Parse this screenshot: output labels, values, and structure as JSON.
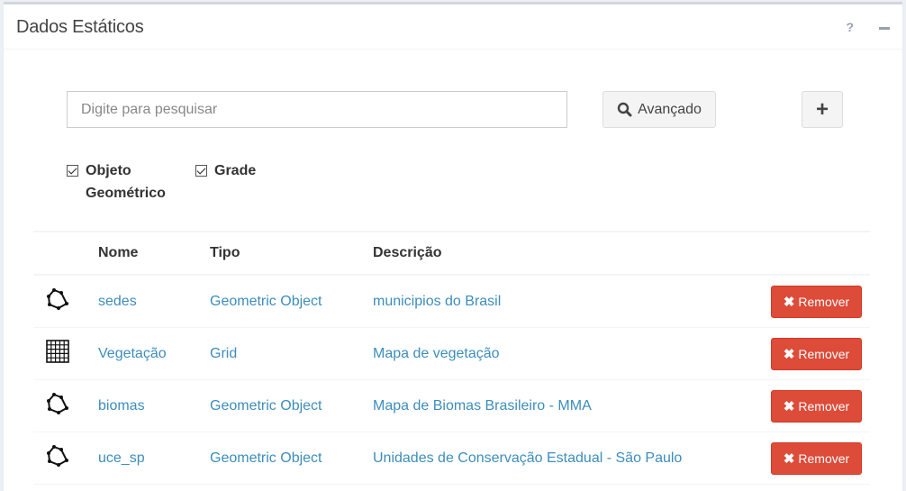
{
  "panel": {
    "title": "Dados Estáticos",
    "help_label": "?"
  },
  "search": {
    "placeholder": "Digite para pesquisar",
    "value": ""
  },
  "buttons": {
    "advanced_label": "Avançado",
    "add_label": "+"
  },
  "filters": [
    {
      "label": "Objeto Geométrico",
      "checked": true
    },
    {
      "label": "Grade",
      "checked": true
    }
  ],
  "table": {
    "headers": [
      "Nome",
      "Tipo",
      "Descrição"
    ],
    "remove_label": "Remover",
    "rows": [
      {
        "icon": "polygon-icon",
        "name": "sedes",
        "type": "Geometric Object",
        "description": "municipios do Brasil"
      },
      {
        "icon": "grid-icon",
        "name": "Vegetação",
        "type": "Grid",
        "description": "Mapa de vegetação"
      },
      {
        "icon": "polygon-icon",
        "name": "biomas",
        "type": "Geometric Object",
        "description": "Mapa de Biomas Brasileiro - MMA"
      },
      {
        "icon": "polygon-icon",
        "name": "uce_sp",
        "type": "Geometric Object",
        "description": "Unidades de Conservação Estadual - São Paulo"
      }
    ]
  },
  "colors": {
    "link": "#3c8dbc",
    "danger": "#dd4b39",
    "box_border": "#d2d6de"
  }
}
